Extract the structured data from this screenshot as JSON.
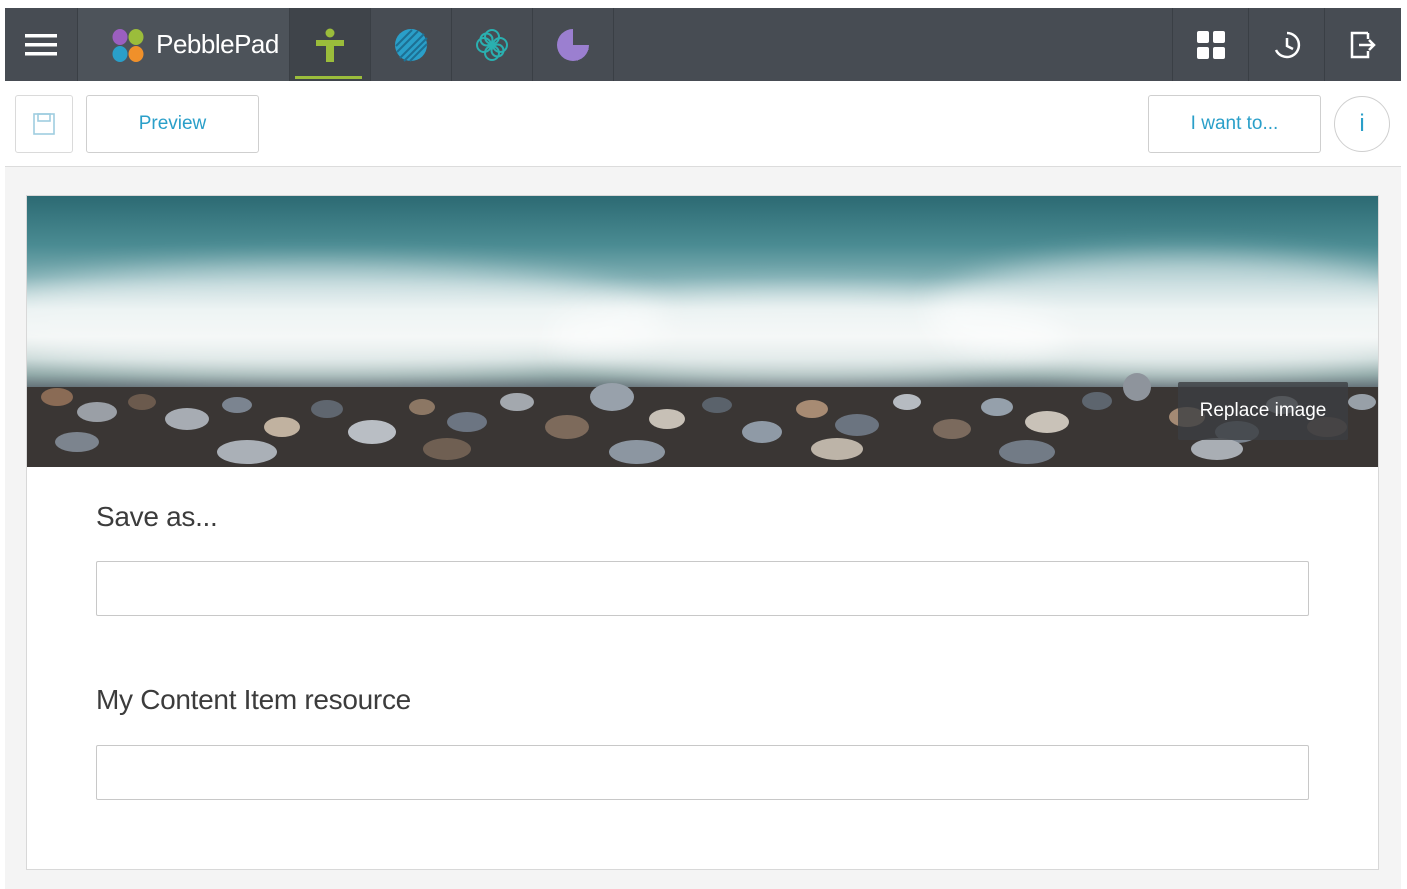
{
  "topbar": {
    "brand": "PebblePad",
    "apps": [
      "person-app-icon",
      "globe-app-icon",
      "flower-app-icon",
      "pie-app-icon"
    ],
    "right_icons": [
      "grid-icon",
      "history-icon",
      "logout-icon"
    ],
    "accent": "#9bbd3b"
  },
  "toolbar": {
    "preview_label": "Preview",
    "iwant_label": "I want to...",
    "info_label": "i"
  },
  "banner": {
    "replace_label": "Replace image"
  },
  "form": {
    "save_as_label": "Save as...",
    "save_as_value": "",
    "resource_label": "My Content Item resource",
    "resource_value": ""
  },
  "colors": {
    "link": "#2a9fc9",
    "nav_bg": "#474c53"
  }
}
